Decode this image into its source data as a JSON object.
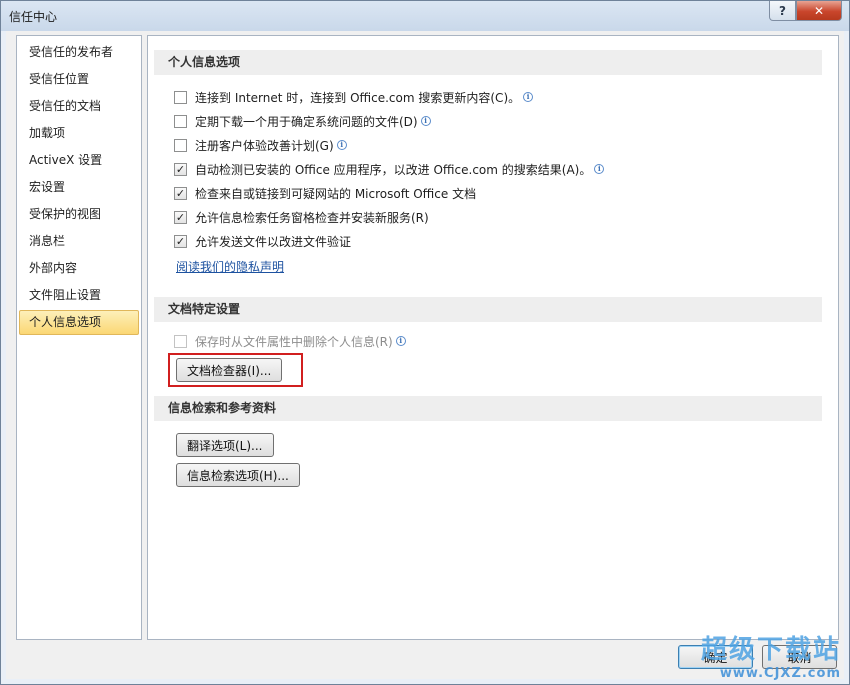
{
  "window": {
    "title": "信任中心",
    "help_label": "?",
    "close_label": "✕"
  },
  "nav": {
    "items": [
      {
        "label": "受信任的发布者"
      },
      {
        "label": "受信任位置"
      },
      {
        "label": "受信任的文档"
      },
      {
        "label": "加载项"
      },
      {
        "label": "ActiveX 设置"
      },
      {
        "label": "宏设置"
      },
      {
        "label": "受保护的视图"
      },
      {
        "label": "消息栏"
      },
      {
        "label": "外部内容"
      },
      {
        "label": "文件阻止设置"
      },
      {
        "label": "个人信息选项"
      }
    ],
    "selected": "个人信息选项"
  },
  "personal": {
    "header": "个人信息选项",
    "options": [
      {
        "label": "连接到 Internet 时，连接到 Office.com 搜索更新内容(C)。",
        "checked": false,
        "info": true
      },
      {
        "label": "定期下载一个用于确定系统问题的文件(D)",
        "checked": false,
        "info": true
      },
      {
        "label": "注册客户体验改善计划(G)",
        "checked": false,
        "info": true
      },
      {
        "label": "自动检测已安装的 Office 应用程序，以改进 Office.com 的搜索结果(A)。",
        "checked": true,
        "info": true
      },
      {
        "label": "检查来自或链接到可疑网站的 Microsoft Office 文档",
        "checked": true,
        "info": false
      },
      {
        "label": "允许信息检索任务窗格检查并安装新服务(R)",
        "checked": true,
        "info": false
      },
      {
        "label": "允许发送文件以改进文件验证",
        "checked": true,
        "info": false
      }
    ],
    "privacy_link": "阅读我们的隐私声明"
  },
  "document": {
    "header": "文档特定设置",
    "remove_info_label": "保存时从文件属性中删除个人信息(R)",
    "inspector_button": "文档检查器(I)..."
  },
  "research": {
    "header": "信息检索和参考资料",
    "translation_button": "翻译选项(L)...",
    "research_button": "信息检索选项(H)..."
  },
  "footer": {
    "ok_label": "确定",
    "cancel_label": "取消"
  },
  "watermark": {
    "text": "超级下载站",
    "url": "www.CJXZ.com"
  },
  "colors": {
    "highlight": "#d11f1f",
    "selected_nav": "#fbd774"
  },
  "icons": {
    "info": "info-icon",
    "check": "checkmark-icon"
  }
}
